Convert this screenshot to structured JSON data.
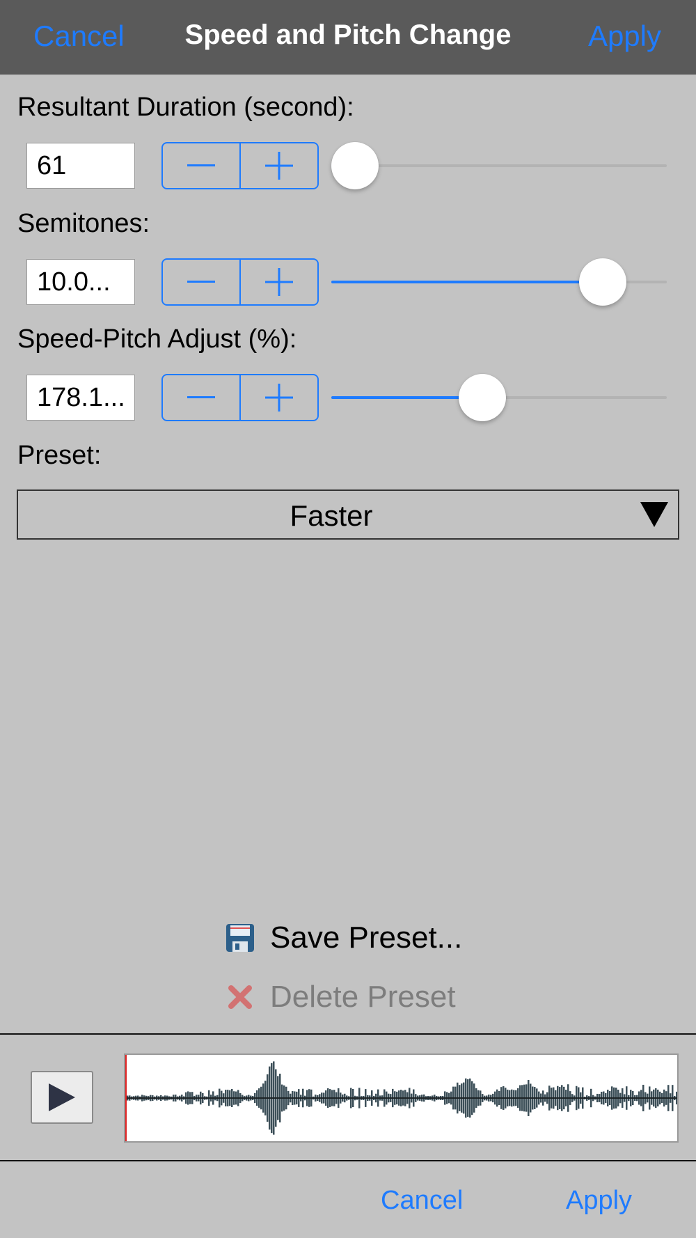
{
  "header": {
    "cancel_label": "Cancel",
    "title": "Speed and Pitch Change",
    "apply_label": "Apply"
  },
  "duration": {
    "label": "Resultant Duration (second):",
    "value": "61",
    "slider_fraction": 0.07
  },
  "semitones": {
    "label": "Semitones:",
    "value": "10.0...",
    "slider_fraction": 0.81
  },
  "speed_pitch": {
    "label": "Speed-Pitch Adjust (%):",
    "value": "178.1...",
    "slider_fraction": 0.45
  },
  "preset": {
    "label": "Preset:",
    "selected": "Faster"
  },
  "actions": {
    "save_label": "Save Preset...",
    "delete_label": "Delete Preset"
  },
  "footer": {
    "cancel_label": "Cancel",
    "apply_label": "Apply"
  },
  "colors": {
    "accent": "#1e7bff",
    "waveform": "#3c4f58",
    "playhead": "#e02020"
  },
  "icons": {
    "save": "floppy-disk-icon",
    "delete": "red-x-icon",
    "play": "play-icon"
  }
}
